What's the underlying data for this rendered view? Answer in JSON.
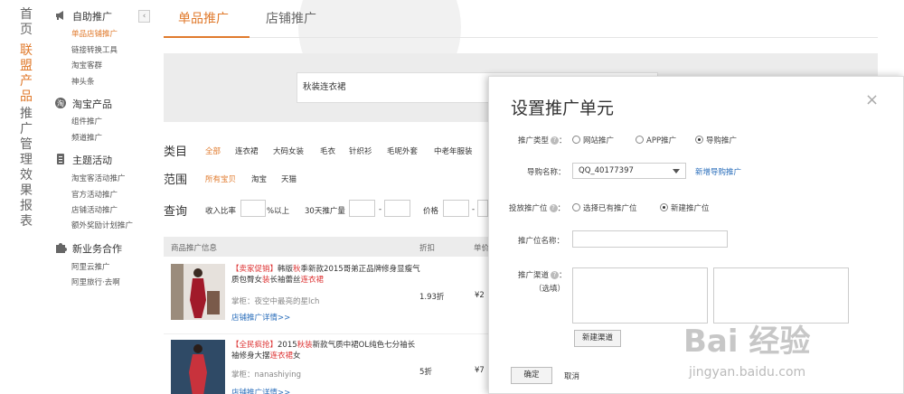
{
  "vnav": [
    {
      "label": "首页",
      "active": false
    },
    {
      "label": "联盟产品",
      "active": true
    },
    {
      "label": "推广管理",
      "active": false
    },
    {
      "label": "效果报表",
      "active": false
    }
  ],
  "sidebar": {
    "collapse_icon": "‹",
    "sections": [
      {
        "title": "自助推广",
        "icon": "megaphone-icon",
        "items": [
          "单品店铺推广",
          "链接转换工具",
          "淘宝客群",
          "神头条"
        ]
      },
      {
        "title": "淘宝产品",
        "icon": "taobao-icon",
        "items": [
          "组件推广",
          "频道推广"
        ]
      },
      {
        "title": "主题活动",
        "icon": "list-icon",
        "items": [
          "淘宝客活动推广",
          "官方活动推广",
          "店铺活动推广",
          "额外奖励计划推广"
        ]
      },
      {
        "title": "新业务合作",
        "icon": "puzzle-icon",
        "items": [
          "阿里云推广",
          "阿里旅行·去啊"
        ]
      }
    ],
    "active_item": "单品店铺推广"
  },
  "tabs": [
    "单品推广",
    "店铺推广"
  ],
  "search": {
    "value": "秋装连衣裙"
  },
  "filters": {
    "category_label": "类目",
    "categories": [
      "全部",
      "连衣裙",
      "大码女装",
      "毛衣",
      "针织衫",
      "毛呢外套",
      "中老年服装"
    ],
    "scope_label": "范围",
    "scopes": [
      "所有宝贝",
      "淘宝",
      "天猫"
    ],
    "query_label": "查询",
    "ratio_label": "收入比率",
    "ratio_suffix": "%以上",
    "volume_label": "30天推广量",
    "dash": "-",
    "price_label": "价格"
  },
  "table": {
    "headers": [
      "商品推广信息",
      "折扣",
      "单价"
    ],
    "rows": [
      {
        "tag": "【卖家促销】",
        "title_parts": [
          "韩版",
          "秋",
          "季新款2015哥弟正品牌修身显瘦气质包臀女",
          "装",
          "长袖蕾丝",
          "连衣裙"
        ],
        "shop": "掌柜：夜空中最亮的星lch",
        "detail": "店铺推广详情>>",
        "discount": "1.93折",
        "price": "¥2"
      },
      {
        "tag": "【全民疯抢】",
        "title_parts": [
          "2015",
          "秋装",
          "新款气质中裙OL纯色七分袖长袖修身大摆",
          "连衣裙",
          "女"
        ],
        "shop": "掌柜：nanashiying",
        "detail": "店铺推广详情>>",
        "discount": "5折",
        "price": "¥7"
      }
    ]
  },
  "modal": {
    "title": "设置推广单元",
    "close_icon": "×",
    "promo_type_label": "推广类型",
    "promo_types": [
      "网站推广",
      "APP推广",
      "导购推广"
    ],
    "promo_type_selected": "导购推广",
    "guide_name_label": "导购名称：",
    "guide_name_value": "QQ_40177397",
    "new_guide_link": "新增导购推广",
    "slot_label": "投放推广位",
    "slot_options": [
      "选择已有推广位",
      "新建推广位"
    ],
    "slot_selected": "新建推广位",
    "slot_name_label": "推广位名称：",
    "channel_label": "推广渠道",
    "channel_optional": "（选填）",
    "new_channel_button": "新建渠道",
    "confirm_button": "确定",
    "cancel_button": "取消",
    "help_glyph": "?"
  },
  "watermark": {
    "logo": "Bai 经验",
    "url": "jingyan.baidu.com"
  }
}
